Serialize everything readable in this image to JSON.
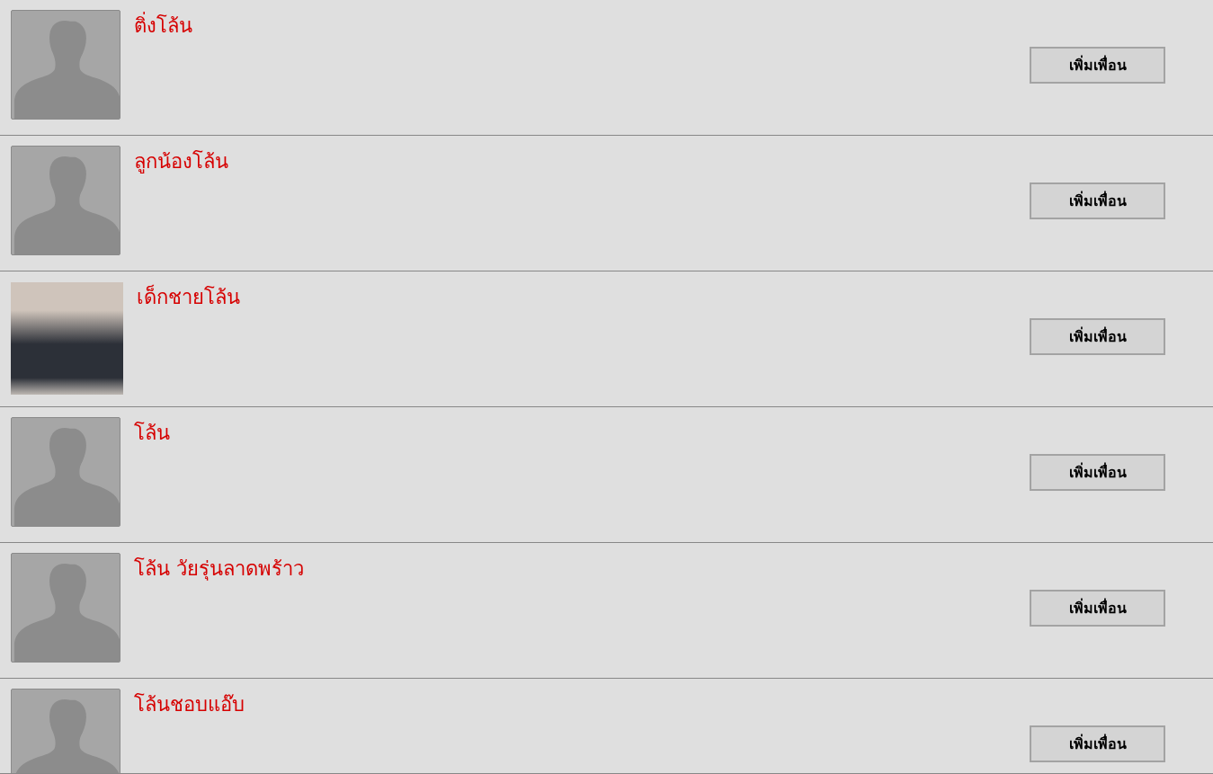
{
  "people": [
    {
      "name": "ติ่งโล้น",
      "kind": "silhouette",
      "button": "เพิ่มเพื่อน"
    },
    {
      "name": "ลูกน้องโล้น",
      "kind": "silhouette",
      "button": "เพิ่มเพื่อน"
    },
    {
      "name": "เด็กชายโล้น",
      "kind": "photo",
      "button": "เพิ่มเพื่อน"
    },
    {
      "name": "โล้น",
      "kind": "silhouette",
      "button": "เพิ่มเพื่อน"
    },
    {
      "name": "โล้น วัยรุ่นลาดพร้าว",
      "kind": "silhouette",
      "button": "เพิ่มเพื่อน"
    },
    {
      "name": "โล้นชอบแอ๊บ",
      "kind": "silhouette",
      "button": "เพิ่มเพื่อน"
    }
  ]
}
